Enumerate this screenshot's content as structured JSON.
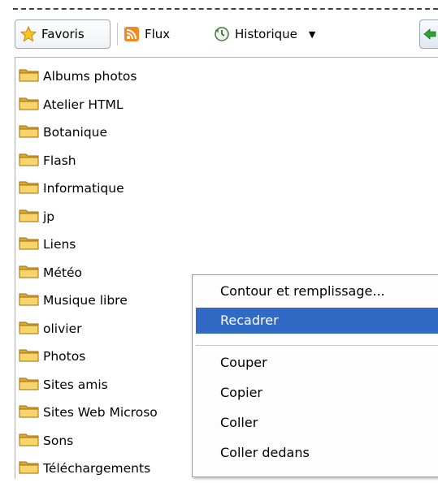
{
  "toolbar": {
    "favorites_label": "Favoris",
    "feeds_label": "Flux",
    "history_label": "Historique"
  },
  "folders": [
    "Albums photos",
    "Atelier HTML",
    "Botanique",
    "Flash",
    "Informatique",
    "jp",
    "Liens",
    "Météo",
    "Musique libre",
    "olivier",
    "Photos",
    "Sites amis",
    "Sites Web Microso",
    "Sons",
    "Téléchargements"
  ],
  "context_menu": {
    "items": [
      "Contour et remplissage...",
      "Recadrer",
      "Couper",
      "Copier",
      "Coller",
      "Coller dedans"
    ],
    "highlighted": "Recadrer"
  },
  "colors": {
    "highlight": "#316ac5",
    "folder": "#f4c94a"
  }
}
